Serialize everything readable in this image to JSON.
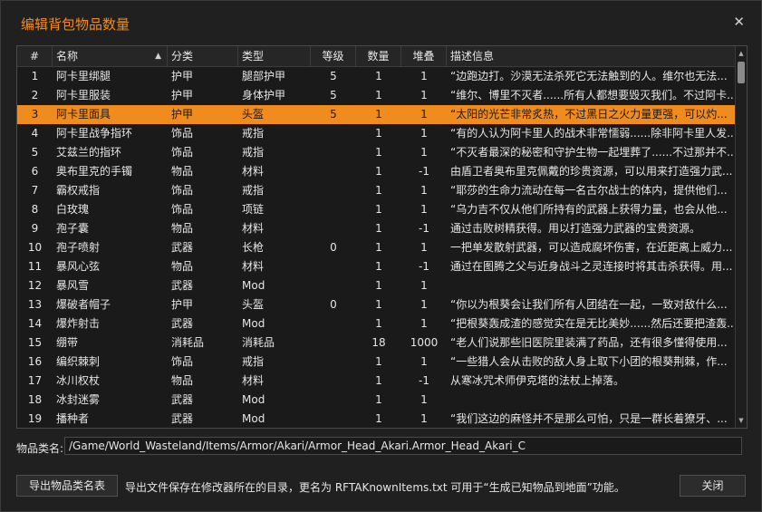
{
  "window": {
    "title": "编辑背包物品数量",
    "close_glyph": "✕"
  },
  "table": {
    "headers": [
      "#",
      "名称",
      "分类",
      "类型",
      "等级",
      "数量",
      "堆叠",
      "描述信息"
    ],
    "rows": [
      [
        "1",
        "阿卡里绑腿",
        "护甲",
        "腿部护甲",
        "5",
        "1",
        "1",
        "“边跑边打。沙漠无法杀死它无法触到的人。维尔也无法..."
      ],
      [
        "2",
        "阿卡里服装",
        "护甲",
        "身体护甲",
        "5",
        "1",
        "1",
        "“维尔、博里不灭者......所有人都想要毁灭我们。不过阿卡..."
      ],
      [
        "3",
        "阿卡里面具",
        "护甲",
        "头盔",
        "5",
        "1",
        "1",
        "“太阳的光芒非常炙热，不过黑日之火力量更强，可以灼..."
      ],
      [
        "4",
        "阿卡里战争指环",
        "饰品",
        "戒指",
        "",
        "1",
        "1",
        "“有的人认为阿卡里人的战术非常懦弱......除非阿卡里人发..."
      ],
      [
        "5",
        "艾兹兰的指环",
        "饰品",
        "戒指",
        "",
        "1",
        "1",
        "“不灭者最深的秘密和守护生物一起埋葬了......不过那并不..."
      ],
      [
        "6",
        "奥布里克的手镯",
        "物品",
        "材料",
        "",
        "1",
        "-1",
        "由盾卫者奥布里克佩戴的珍贵资源，可以用来打造强力武..."
      ],
      [
        "7",
        "霸权戒指",
        "饰品",
        "戒指",
        "",
        "1",
        "1",
        "“耶莎的生命力流动在每一名古尔战士的体内，提供他们..."
      ],
      [
        "8",
        "白玫瑰",
        "饰品",
        "项链",
        "",
        "1",
        "1",
        "“乌力吉不仅从他们所持有的武器上获得力量，也会从他..."
      ],
      [
        "9",
        "孢子囊",
        "物品",
        "材料",
        "",
        "1",
        "-1",
        "通过击败树精获得。用以打造强力武器的宝贵资源。"
      ],
      [
        "10",
        "孢子喷射",
        "武器",
        "长枪",
        "0",
        "1",
        "1",
        "一把单发散射武器，可以造成腐坏伤害，在近距离上威力..."
      ],
      [
        "11",
        "暴风心弦",
        "物品",
        "材料",
        "",
        "1",
        "-1",
        "通过在图腾之父与近身战斗之灵连接时将其击杀获得。用..."
      ],
      [
        "12",
        "暴风雪",
        "武器",
        "Mod",
        "",
        "1",
        "1",
        ""
      ],
      [
        "13",
        "爆破者帽子",
        "护甲",
        "头盔",
        "0",
        "1",
        "1",
        "“你以为根葵会让我们所有人团结在一起，一致对敌什么..."
      ],
      [
        "14",
        "爆炸射击",
        "武器",
        "Mod",
        "",
        "1",
        "1",
        "“把根葵轰成渣的感觉实在是无比美妙......然后还要把渣轰..."
      ],
      [
        "15",
        "绷带",
        "消耗品",
        "消耗品",
        "",
        "18",
        "1000",
        "“老人们说那些旧医院里装满了药品，还有很多懂得使用..."
      ],
      [
        "16",
        "编织棘刺",
        "饰品",
        "戒指",
        "",
        "1",
        "1",
        "“一些猎人会从击败的敌人身上取下小团的根葵荆棘，作..."
      ],
      [
        "17",
        "冰川权杖",
        "物品",
        "材料",
        "",
        "1",
        "-1",
        "从寒冰咒术师伊克塔的法杖上掉落。"
      ],
      [
        "18",
        "冰封迷雾",
        "武器",
        "Mod",
        "",
        "1",
        "1",
        ""
      ],
      [
        "19",
        "播种者",
        "武器",
        "Mod",
        "",
        "1",
        "1",
        "“我们这边的麻怪并不是那么可怕，只是一群长着獠牙、..."
      ]
    ],
    "selected_row": 3,
    "sort_column": "名称",
    "sort_icon": "sort-ascending-icon"
  },
  "class_field": {
    "label": "物品类名:",
    "value": "/Game/World_Wasteland/Items/Armor/Akari/Armor_Head_Akari.Armor_Head_Akari_C"
  },
  "footer": {
    "export_label": "导出物品类名表",
    "note": "导出文件保存在修改器所在的目录，更名为 RFTAKnownItems.txt 可用于“生成已知物品到地面”功能。",
    "close_label": "关闭"
  },
  "colors": {
    "accent": "#f08c1e",
    "background": "#202020"
  }
}
